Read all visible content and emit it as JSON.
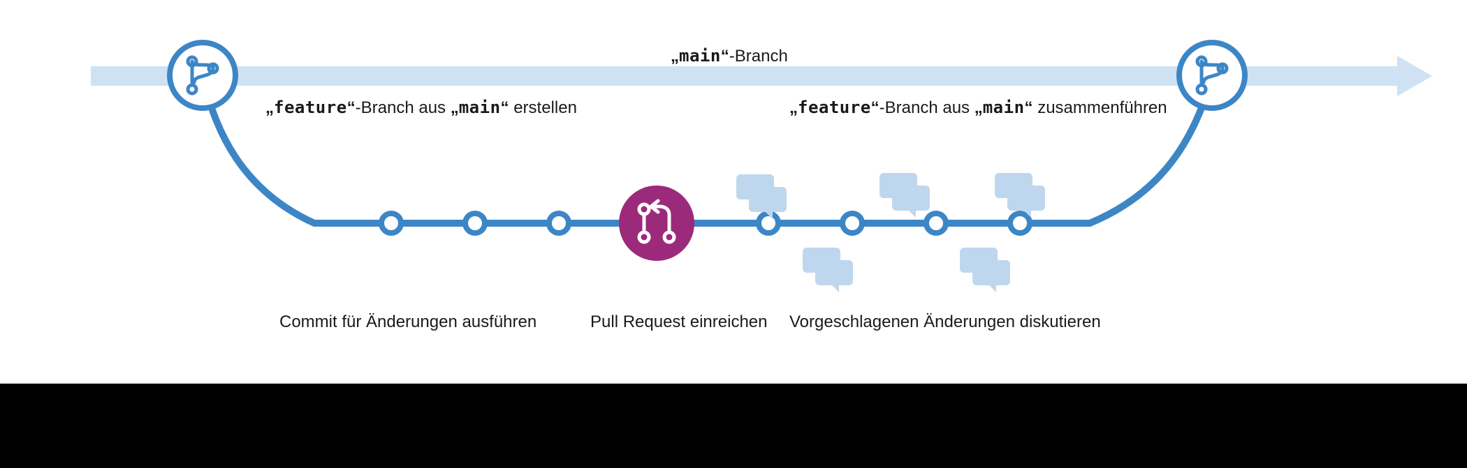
{
  "colors": {
    "main_arrow": "#cfe2f3",
    "branch": "#3d86c6",
    "pr_fill": "#9c2a7a",
    "chat": "#bfd7ee",
    "text": "#1a1a1a"
  },
  "top_label": {
    "q1": "„",
    "main": "main",
    "q2": "“",
    "suffix": "-Branch"
  },
  "create_label": {
    "q1": "„",
    "feature": "feature",
    "q2": "“",
    "mid": "-Branch aus ",
    "q3": "„",
    "main": "main",
    "q4": "“",
    "suffix": " erstellen"
  },
  "merge_label": {
    "q1": "„",
    "feature": "feature",
    "q2": "“",
    "mid": "-Branch aus ",
    "q3": "„",
    "main": "main",
    "q4": "“",
    "suffix": " zusammenführen"
  },
  "bottom": {
    "commit": "Commit für Änderungen ausführen",
    "pr": "Pull Request einreichen",
    "discuss": "Vorgeschlagenen Änderungen diskutieren"
  }
}
